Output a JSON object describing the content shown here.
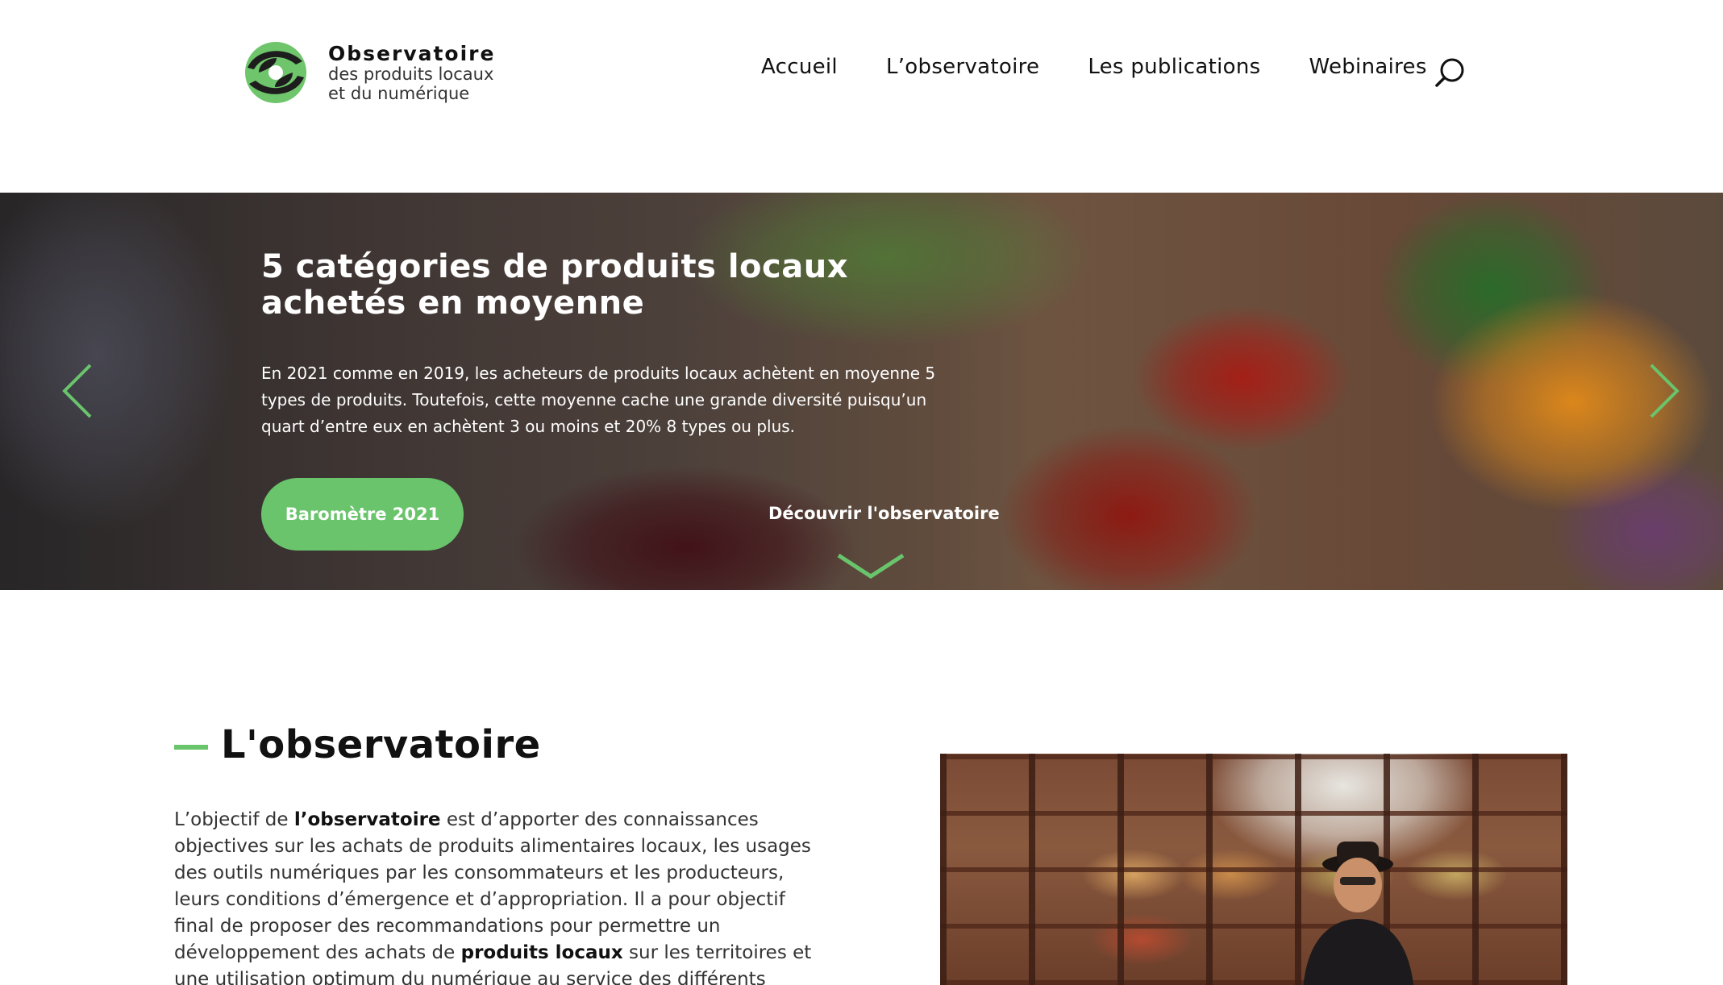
{
  "header": {
    "logo": {
      "title": "Observatoire",
      "line1": "des produits locaux",
      "line2": "et du numérique"
    },
    "nav": [
      {
        "label": "Accueil"
      },
      {
        "label": "L’observatoire"
      },
      {
        "label": "Les publications"
      },
      {
        "label": "Webinaires"
      }
    ],
    "search_icon": "search-icon"
  },
  "hero": {
    "title": "5 catégories de produits locaux achetés en moyenne",
    "text": " En 2021 comme en 2019, les acheteurs de produits locaux achètent en moyenne 5 types de produits. Toutefois, cette moyenne cache une grande diversité puisqu’un quart d’entre eux en achètent 3 ou moins et 20% 8 types ou plus.",
    "button_label": "Baromètre 2021",
    "link_label": "Découvrir l'observatoire",
    "icons": [
      "chevron-left-icon",
      "chevron-right-icon",
      "chevron-down-icon"
    ]
  },
  "section": {
    "title": "L'observatoire",
    "body": {
      "p1": "L’objectif de ",
      "b1": "l’observatoire",
      "p2": " est d’apporter des connaissances objectives sur les achats de produits alimentaires locaux, les usages des outils numériques par les consommateurs et les producteurs, leurs conditions d’émergence et d’appropriation. Il a pour objectif final de proposer des recommandations pour permettre un développement des achats de ",
      "b2": "produits locaux",
      "p3": " sur les territoires et une utilisation optimum du numérique au service des différents"
    }
  },
  "colors": {
    "accent": "#69c46c",
    "text": "#111111",
    "white": "#ffffff"
  }
}
